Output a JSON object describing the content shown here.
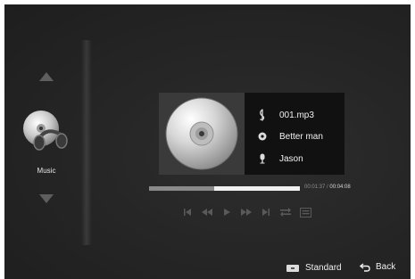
{
  "sidebar": {
    "up_icon": "chevron-up-icon",
    "down_icon": "chevron-down-icon",
    "active_item": {
      "label": "Music",
      "icon": "music-cd-headphones-icon"
    }
  },
  "now_playing": {
    "cover_icon": "cd-disc-icon",
    "filename": "001.mp3",
    "title": "Better man",
    "artist": "Jason",
    "filename_icon": "treble-clef-icon",
    "title_icon": "disc-icon",
    "artist_icon": "microphone-icon"
  },
  "progress": {
    "fraction": 0.43,
    "elapsed": "00:01:37",
    "separator": "/",
    "total": "00:04:08"
  },
  "controls": [
    {
      "name": "skip-previous-icon"
    },
    {
      "name": "rewind-icon"
    },
    {
      "name": "play-icon"
    },
    {
      "name": "fast-forward-icon"
    },
    {
      "name": "skip-next-icon"
    },
    {
      "name": "repeat-icon"
    },
    {
      "name": "playlist-icon"
    }
  ],
  "footer": {
    "standard_label": "Standard",
    "back_label": "Back"
  },
  "colors": {
    "background": "#262626",
    "panel": "#111111",
    "text": "#f2f2f2",
    "muted": "#8a8a8a"
  }
}
